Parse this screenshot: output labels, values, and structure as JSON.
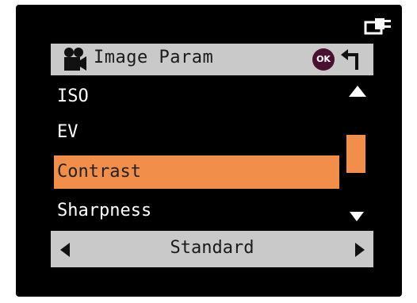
{
  "header": {
    "title": "Image Param",
    "ok_label": "OK",
    "icon": "movie-camera-icon",
    "back_icon": "return-arrow-icon"
  },
  "status": {
    "power_icon": "power-plug-icon"
  },
  "menu": {
    "items": [
      {
        "label": "ISO"
      },
      {
        "label": "EV"
      },
      {
        "label": "Contrast",
        "selected": true
      },
      {
        "label": "Sharpness"
      }
    ]
  },
  "value_bar": {
    "value": "Standard",
    "left_icon": "triangle-left-icon",
    "right_icon": "triangle-right-icon"
  },
  "scroll": {
    "up_icon": "triangle-up-icon",
    "down_icon": "triangle-down-icon"
  },
  "colors": {
    "selection": "#f08e4a",
    "bar": "#c9c9c9",
    "background": "#000000"
  }
}
